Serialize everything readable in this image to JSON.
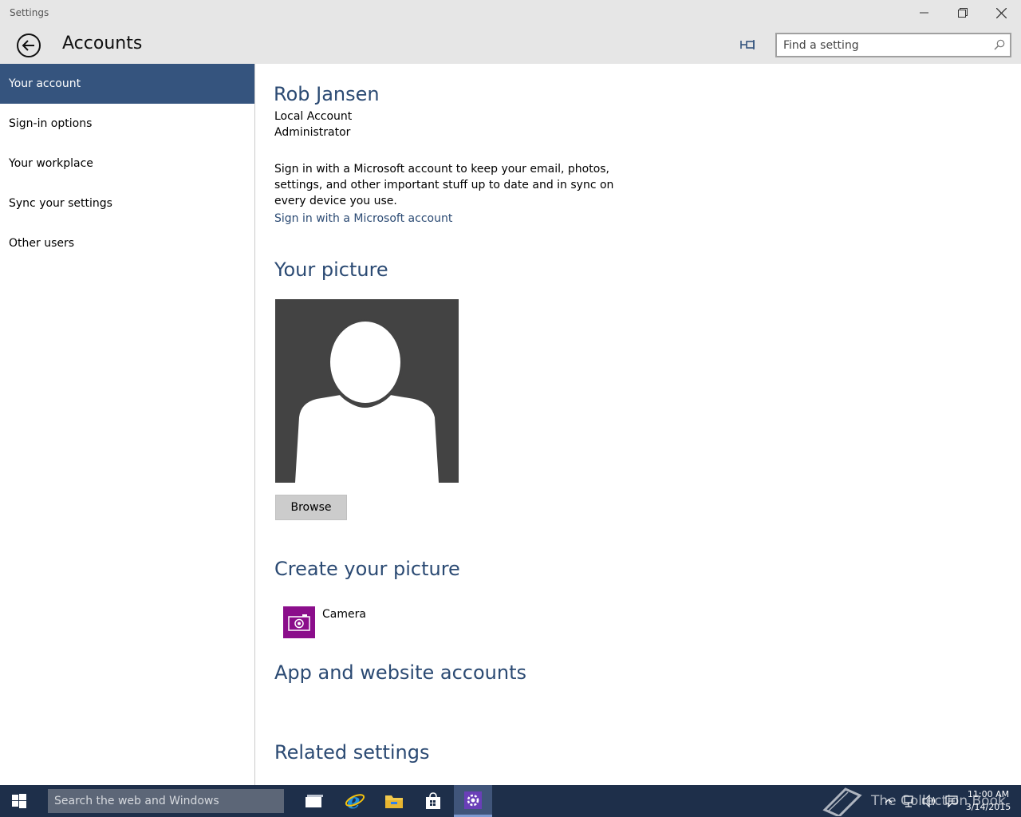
{
  "window": {
    "title": "Settings"
  },
  "header": {
    "title": "Accounts",
    "search_placeholder": "Find a setting"
  },
  "sidebar": {
    "items": [
      {
        "label": "Your account",
        "active": true
      },
      {
        "label": "Sign-in options",
        "active": false
      },
      {
        "label": "Your workplace",
        "active": false
      },
      {
        "label": "Sync your settings",
        "active": false
      },
      {
        "label": "Other users",
        "active": false
      }
    ]
  },
  "account": {
    "name": "Rob Jansen",
    "type": "Local Account",
    "role": "Administrator",
    "description": "Sign in with a Microsoft account to keep your email, photos, settings, and other important stuff up to date and in sync on every device you use.",
    "signin_link": "Sign in with a Microsoft account"
  },
  "picture": {
    "section_title": "Your picture",
    "browse_label": "Browse"
  },
  "create_picture": {
    "section_title": "Create your picture",
    "camera_label": "Camera"
  },
  "app_accounts": {
    "section_title": "App and website accounts"
  },
  "related": {
    "section_title": "Related settings"
  },
  "taskbar": {
    "search_placeholder": "Search the web and Windows",
    "time": "11:00 AM",
    "date": "3/14/2015",
    "watermark": "The Collection Book"
  },
  "colors": {
    "accent": "#35547e",
    "heading": "#2b4a73",
    "taskbar": "#1e2f4a",
    "camera_tile": "#8b0e8b"
  }
}
